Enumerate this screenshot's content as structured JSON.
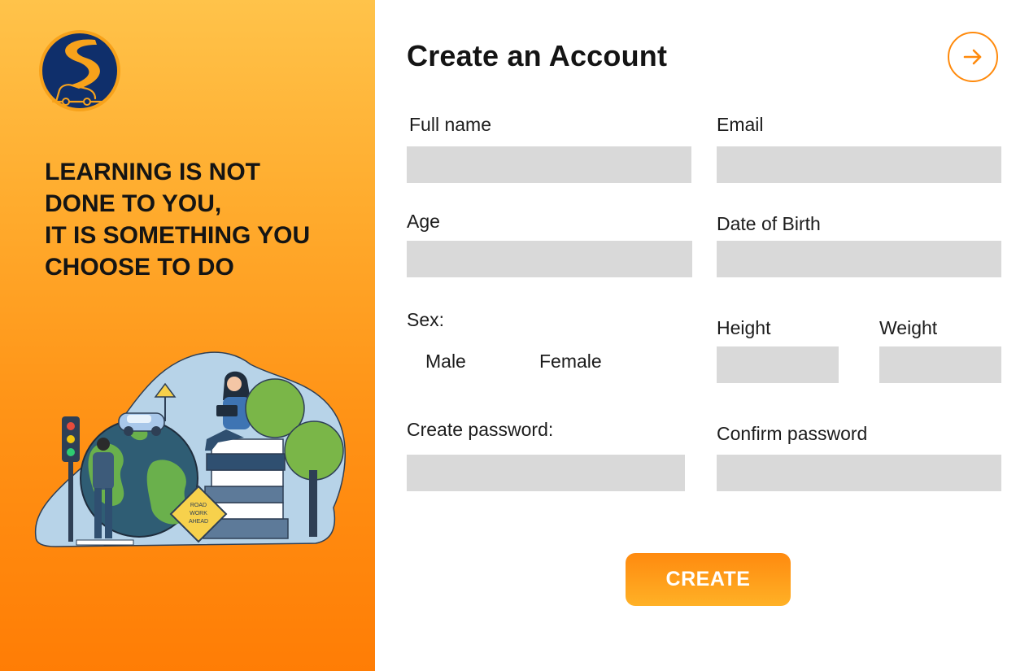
{
  "brand": {
    "logo_icon": "road-logo-icon"
  },
  "quote": [
    "LEARNING IS NOT",
    "DONE TO YOU,",
    "IT IS SOMETHING YOU",
    "CHOOSE TO DO"
  ],
  "illustration": {
    "sign_text": [
      "ROAD",
      "WORK",
      "AHEAD"
    ]
  },
  "form": {
    "title": "Create an Account",
    "next_icon": "arrow-right-icon",
    "full_name": {
      "label": "Full name",
      "value": ""
    },
    "email": {
      "label": "Email",
      "value": ""
    },
    "age": {
      "label": "Age",
      "value": ""
    },
    "dob": {
      "label": "Date of Birth",
      "value": ""
    },
    "sex": {
      "label": "Sex:",
      "options": [
        "Male",
        "Female"
      ]
    },
    "height": {
      "label": "Height",
      "value": ""
    },
    "weight": {
      "label": "Weight",
      "value": ""
    },
    "password": {
      "label": "Create password:",
      "value": ""
    },
    "confirm_password": {
      "label": "Confirm password",
      "value": ""
    },
    "submit_label": "CREATE"
  },
  "colors": {
    "accent": "#ff8a0c",
    "panel_top": "#ffc34a",
    "panel_bottom": "#ff7d05",
    "logo_navy": "#0f2f6b",
    "input_bg": "#d9d9d9"
  }
}
